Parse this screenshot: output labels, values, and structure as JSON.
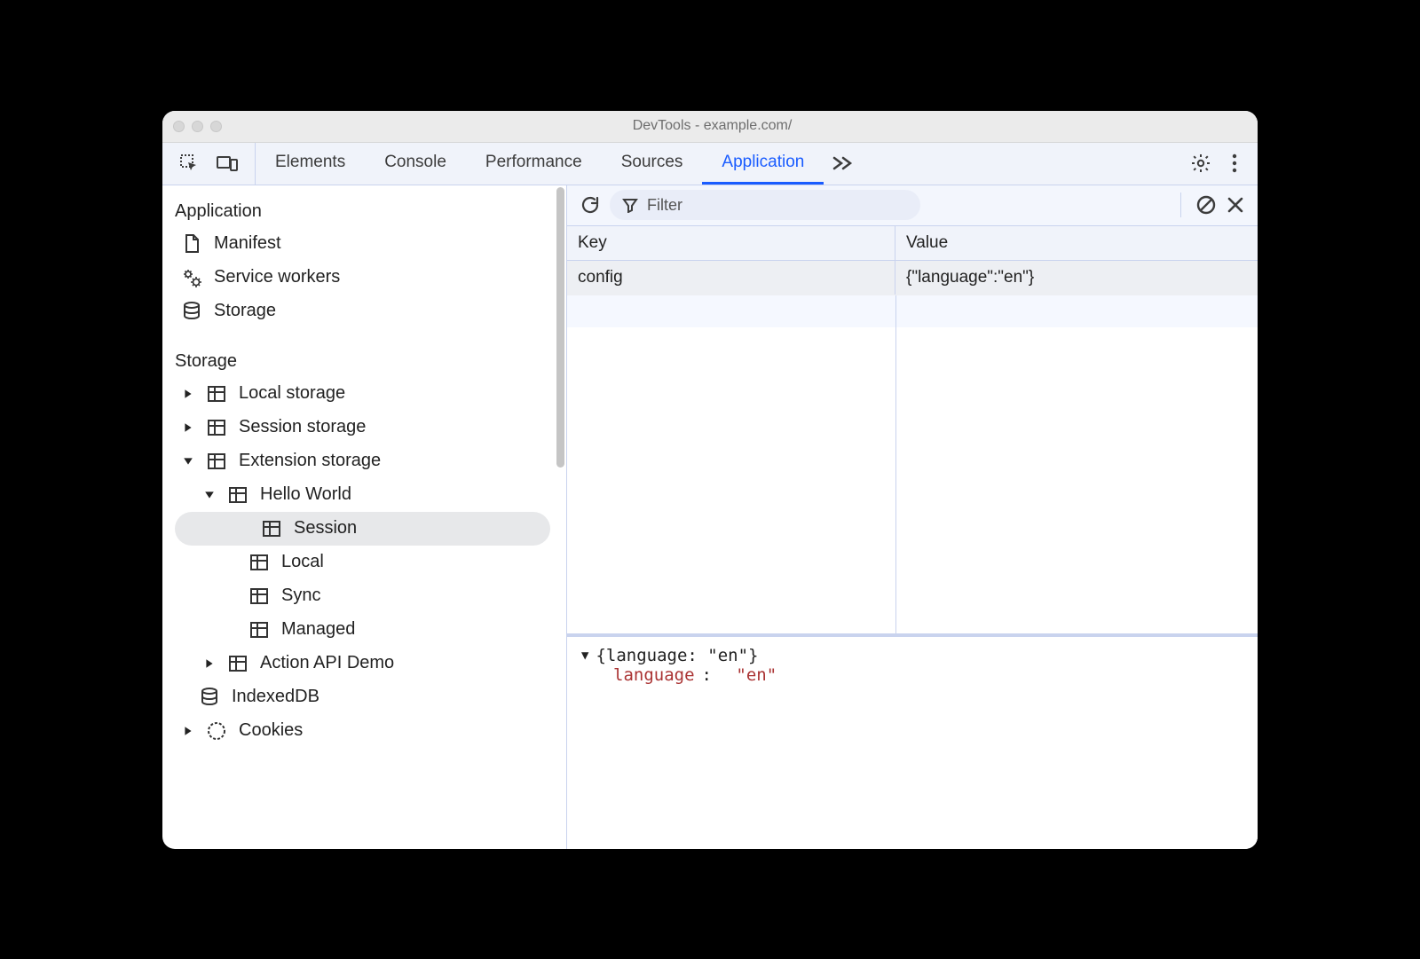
{
  "window": {
    "title": "DevTools - example.com/"
  },
  "tabs": {
    "items": [
      "Elements",
      "Console",
      "Performance",
      "Sources",
      "Application"
    ],
    "activeIndex": 4
  },
  "sidebar": {
    "sections": {
      "application": {
        "heading": "Application",
        "items": [
          {
            "label": "Manifest",
            "icon": "document-icon"
          },
          {
            "label": "Service workers",
            "icon": "gears-icon"
          },
          {
            "label": "Storage",
            "icon": "database-icon"
          }
        ]
      },
      "storage": {
        "heading": "Storage",
        "items": [
          {
            "label": "Local storage",
            "icon": "table-icon",
            "expandable": true,
            "expanded": false
          },
          {
            "label": "Session storage",
            "icon": "table-icon",
            "expandable": true,
            "expanded": false
          },
          {
            "label": "Extension storage",
            "icon": "table-icon",
            "expandable": true,
            "expanded": true,
            "children": [
              {
                "label": "Hello World",
                "icon": "table-icon",
                "expandable": true,
                "expanded": true,
                "children": [
                  {
                    "label": "Session",
                    "icon": "table-icon",
                    "selected": true
                  },
                  {
                    "label": "Local",
                    "icon": "table-icon"
                  },
                  {
                    "label": "Sync",
                    "icon": "table-icon"
                  },
                  {
                    "label": "Managed",
                    "icon": "table-icon"
                  }
                ]
              },
              {
                "label": "Action API Demo",
                "icon": "table-icon",
                "expandable": true,
                "expanded": false
              }
            ]
          },
          {
            "label": "IndexedDB",
            "icon": "database-icon"
          },
          {
            "label": "Cookies",
            "icon": "cookie-icon",
            "expandable": true,
            "expanded": false
          }
        ]
      }
    }
  },
  "filter": {
    "placeholder": "Filter",
    "value": ""
  },
  "table": {
    "headers": {
      "key": "Key",
      "value": "Value"
    },
    "rows": [
      {
        "key": "config",
        "value": "{\"language\":\"en\"}"
      }
    ]
  },
  "preview": {
    "summary": "{language: \"en\"}",
    "prop_key": "language",
    "prop_value": "\"en\""
  }
}
